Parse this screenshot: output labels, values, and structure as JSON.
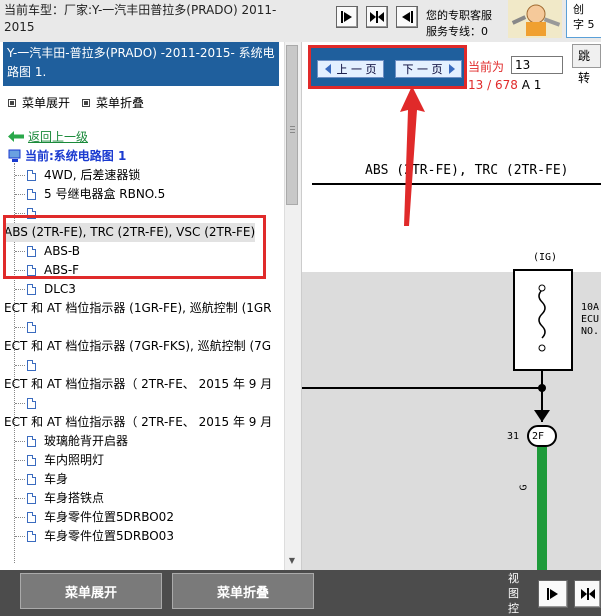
{
  "header": {
    "car_model_label": "当前车型：厂家:Y-一汽丰田普拉多(PRADO) 2011-2015",
    "service_line1": "您的专职客服",
    "service_line2": "服务专线：0",
    "brand_line1": "创",
    "brand_line2": "字 5"
  },
  "left": {
    "model_title": "Y-一汽丰田-普拉多(PRADO) -2011-2015- 系统电路图 1.",
    "menu_expand": "菜单展开",
    "menu_collapse": "菜单折叠",
    "back_link": "返回上一级",
    "current_node": "当前:系统电路图 1",
    "tree_items": [
      {
        "label": "4WD, 后差速器锁",
        "indent": 1
      },
      {
        "label": "5 号继电器盒 RBNO.5",
        "indent": 1
      },
      {
        "label": "",
        "indent": 1
      },
      {
        "label": "ABS (2TR-FE), TRC (2TR-FE), VSC (2TR-FE)",
        "indent": 0
      },
      {
        "label": "ABS-B",
        "indent": 1
      },
      {
        "label": "ABS-F",
        "indent": 1
      },
      {
        "label": "DLC3",
        "indent": 1
      },
      {
        "label": "ECT 和 AT 档位指示器 (1GR-FE), 巡航控制 (1GR",
        "indent": 0
      },
      {
        "label": "",
        "indent": 1
      },
      {
        "label": "ECT 和 AT 档位指示器 (7GR-FKS), 巡航控制 (7G",
        "indent": 0
      },
      {
        "label": "",
        "indent": 1
      },
      {
        "label": "ECT 和 AT 档位指示器（ 2TR-FE、 2015 年 9 月",
        "indent": 0
      },
      {
        "label": "",
        "indent": 1
      },
      {
        "label": "ECT 和 AT 档位指示器（ 2TR-FE、 2015 年 9 月",
        "indent": 0
      },
      {
        "label": "玻璃舱背开启器",
        "indent": 1
      },
      {
        "label": "车内照明灯",
        "indent": 1
      },
      {
        "label": "车身",
        "indent": 1
      },
      {
        "label": "车身搭铁点",
        "indent": 1
      },
      {
        "label": "车身零件位置5DRBO02",
        "indent": 1
      },
      {
        "label": "车身零件位置5DRBO03",
        "indent": 1
      }
    ]
  },
  "pager": {
    "prev_label": "上 一 页",
    "next_label": "下 一 页",
    "current_label": "当前为",
    "page_value": "13",
    "jump_label": "跳转",
    "page_count": "13 / 678",
    "page_suffix": "A 1"
  },
  "diagram": {
    "title": "ABS (2TR-FE), TRC (2TR-FE)",
    "ig_label": "(IG)",
    "right_text1": "10A",
    "right_text2": "ECU",
    "right_text3": "NO.",
    "pin_number": "31",
    "connector": "2F",
    "wire_color": "G"
  },
  "bottom": {
    "expand_btn": "菜单展开",
    "collapse_btn": "菜单折叠",
    "view_ctrl": "视图控"
  }
}
